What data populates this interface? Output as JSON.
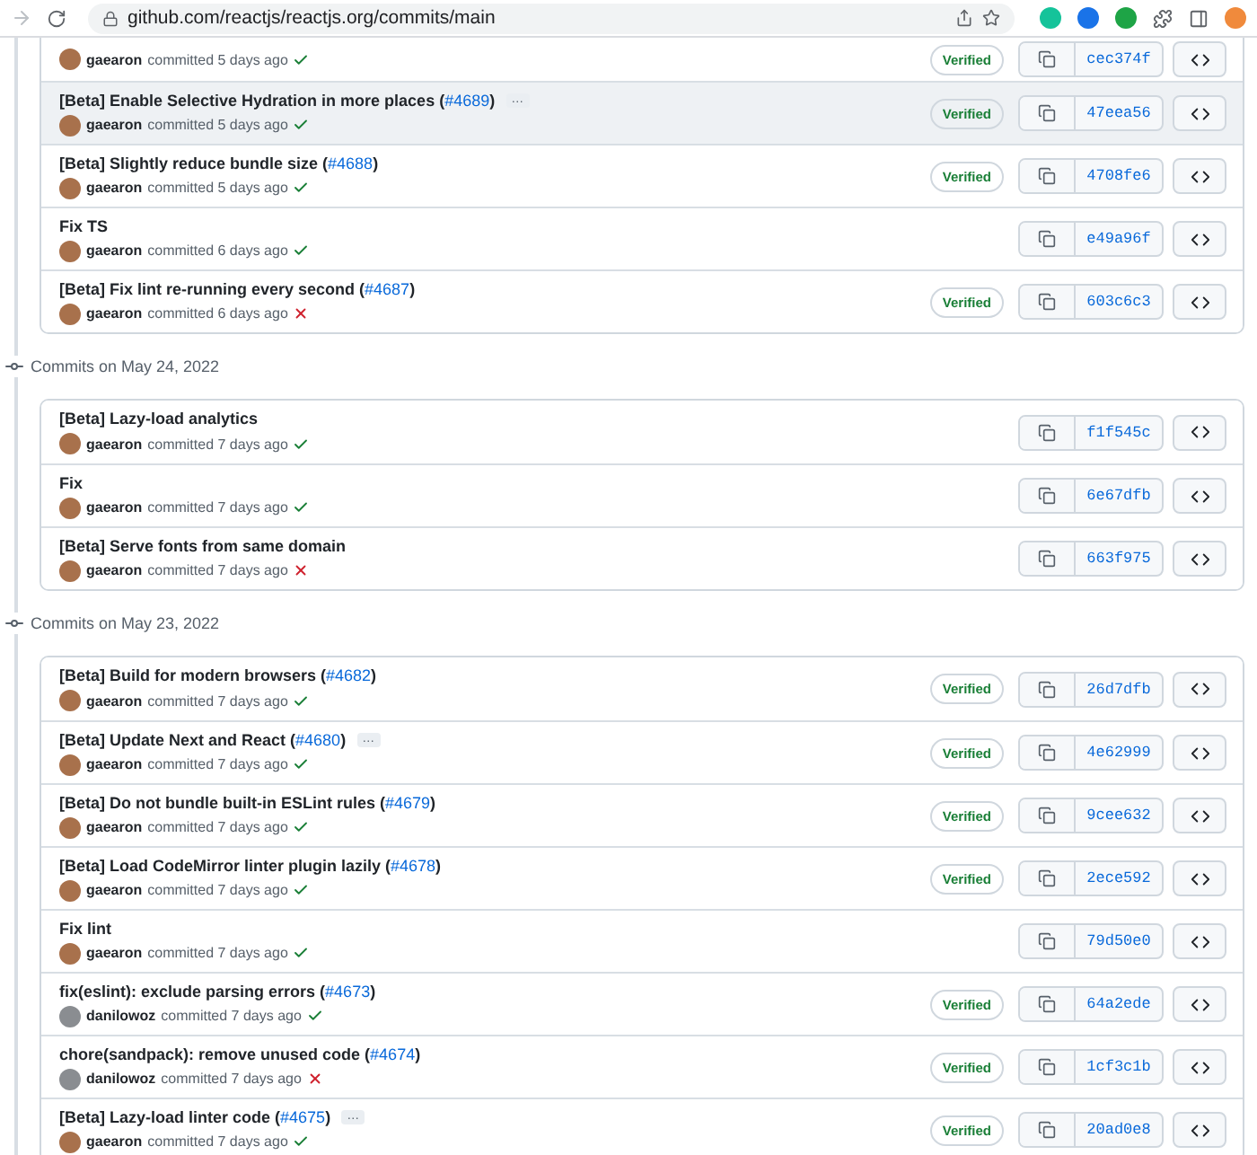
{
  "browser": {
    "url": "github.com/reactjs/reactjs.org/commits/main",
    "back_disabled": true
  },
  "groups": [
    {
      "commits": [
        {
          "author": "gaearon",
          "meta": "committed 5 days ago",
          "passed": true,
          "verified": "Verified",
          "hash": "cec374f",
          "hovered": false,
          "color": "#a8714c"
        },
        {
          "title": "[Beta] Enable Selective Hydration in more places (",
          "pr": "#4689",
          "title_end": ")",
          "more": "…",
          "author": "gaearon",
          "meta": "committed 5 days ago",
          "passed": true,
          "verified": "Verified",
          "hash": "47eea56",
          "hovered": true,
          "color": "#a8714c"
        },
        {
          "title": "[Beta] Slightly reduce bundle size (",
          "pr": "#4688",
          "title_end": ")",
          "author": "gaearon",
          "meta": "committed 5 days ago",
          "passed": true,
          "verified": "Verified",
          "hash": "4708fe6",
          "hovered": false,
          "color": "#a8714c"
        },
        {
          "title": "Fix TS",
          "author": "gaearon",
          "meta": "committed 6 days ago",
          "passed": true,
          "hash": "e49a96f",
          "hovered": false,
          "color": "#a8714c"
        },
        {
          "title": "[Beta] Fix lint re-running every second (",
          "pr": "#4687",
          "title_end": ")",
          "author": "gaearon",
          "meta": "committed 6 days ago",
          "passed": false,
          "verified": "Verified",
          "hash": "603c6c3",
          "hovered": false,
          "color": "#a8714c"
        }
      ]
    },
    {
      "heading": "Commits on May 24, 2022",
      "commits": [
        {
          "title": "[Beta] Lazy-load analytics",
          "author": "gaearon",
          "meta": "committed 7 days ago",
          "passed": true,
          "hash": "f1f545c",
          "hovered": false,
          "color": "#a8714c"
        },
        {
          "title": "Fix",
          "author": "gaearon",
          "meta": "committed 7 days ago",
          "passed": true,
          "hash": "6e67dfb",
          "hovered": false,
          "color": "#a8714c"
        },
        {
          "title": "[Beta] Serve fonts from same domain",
          "author": "gaearon",
          "meta": "committed 7 days ago",
          "passed": false,
          "hash": "663f975",
          "hovered": false,
          "color": "#a8714c"
        }
      ]
    },
    {
      "heading": "Commits on May 23, 2022",
      "commits": [
        {
          "title": "[Beta] Build for modern browsers (",
          "pr": "#4682",
          "title_end": ")",
          "author": "gaearon",
          "meta": "committed 7 days ago",
          "passed": true,
          "verified": "Verified",
          "hash": "26d7dfb",
          "hovered": false,
          "color": "#a8714c"
        },
        {
          "title": "[Beta] Update Next and React (",
          "pr": "#4680",
          "title_end": ")",
          "more": "…",
          "author": "gaearon",
          "meta": "committed 7 days ago",
          "passed": true,
          "verified": "Verified",
          "hash": "4e62999",
          "hovered": false,
          "color": "#a8714c"
        },
        {
          "title": "[Beta] Do not bundle built-in ESLint rules (",
          "pr": "#4679",
          "title_end": ")",
          "author": "gaearon",
          "meta": "committed 7 days ago",
          "passed": true,
          "verified": "Verified",
          "hash": "9cee632",
          "hovered": false,
          "color": "#a8714c"
        },
        {
          "title": "[Beta] Load CodeMirror linter plugin lazily (",
          "pr": "#4678",
          "title_end": ")",
          "author": "gaearon",
          "meta": "committed 7 days ago",
          "passed": true,
          "verified": "Verified",
          "hash": "2ece592",
          "hovered": false,
          "color": "#a8714c"
        },
        {
          "title": "Fix lint",
          "author": "gaearon",
          "meta": "committed 7 days ago",
          "passed": true,
          "hash": "79d50e0",
          "hovered": false,
          "color": "#a8714c"
        },
        {
          "title": "fix(eslint): exclude parsing errors (",
          "pr": "#4673",
          "title_end": ")",
          "author": "danilowoz",
          "meta": "committed 7 days ago",
          "passed": true,
          "verified": "Verified",
          "hash": "64a2ede",
          "hovered": false,
          "color": "#8a8d91"
        },
        {
          "title": "chore(sandpack): remove unused code (",
          "pr": "#4674",
          "title_end": ")",
          "author": "danilowoz",
          "meta": "committed 7 days ago",
          "passed": false,
          "verified": "Verified",
          "hash": "1cf3c1b",
          "hovered": false,
          "color": "#8a8d91"
        },
        {
          "title": "[Beta] Lazy-load linter code (",
          "pr": "#4675",
          "title_end": ")",
          "more": "…",
          "author": "gaearon",
          "meta": "committed 7 days ago",
          "passed": true,
          "verified": "Verified",
          "hash": "20ad0e8",
          "hovered": false,
          "color": "#a8714c"
        }
      ]
    }
  ]
}
